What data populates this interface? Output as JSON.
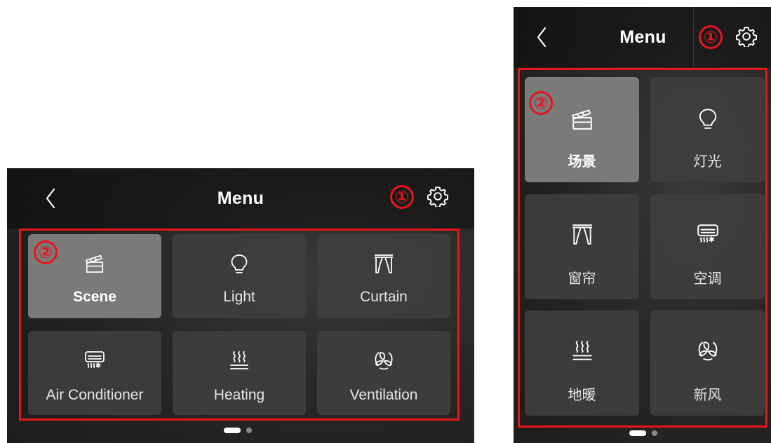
{
  "panel_en": {
    "title": "Menu",
    "badge_settings": "①",
    "badge_grid": "②",
    "tiles": [
      {
        "label": "Scene",
        "icon": "scene-clapperboard-icon",
        "active": true
      },
      {
        "label": "Light",
        "icon": "light-bulb-icon"
      },
      {
        "label": "Curtain",
        "icon": "curtain-icon"
      },
      {
        "label": "Air Conditioner",
        "icon": "air-conditioner-icon"
      },
      {
        "label": "Heating",
        "icon": "heating-icon"
      },
      {
        "label": "Ventilation",
        "icon": "ventilation-icon"
      }
    ],
    "page_indicator": {
      "pages": 2,
      "current": 1
    }
  },
  "panel_zh": {
    "title": "Menu",
    "badge_settings": "①",
    "badge_grid": "②",
    "tiles": [
      {
        "label": "场景",
        "icon": "scene-clapperboard-icon",
        "active": true
      },
      {
        "label": "灯光",
        "icon": "light-bulb-icon"
      },
      {
        "label": "窗帘",
        "icon": "curtain-icon"
      },
      {
        "label": "空调",
        "icon": "air-conditioner-icon"
      },
      {
        "label": "地暖",
        "icon": "heating-icon"
      },
      {
        "label": "新风",
        "icon": "ventilation-icon"
      }
    ],
    "page_indicator": {
      "pages": 2,
      "current": 1
    }
  },
  "colors": {
    "annotation_red": "#e8141c",
    "active_tile": "#7a7a7a",
    "tile": "#3e3e3e"
  }
}
